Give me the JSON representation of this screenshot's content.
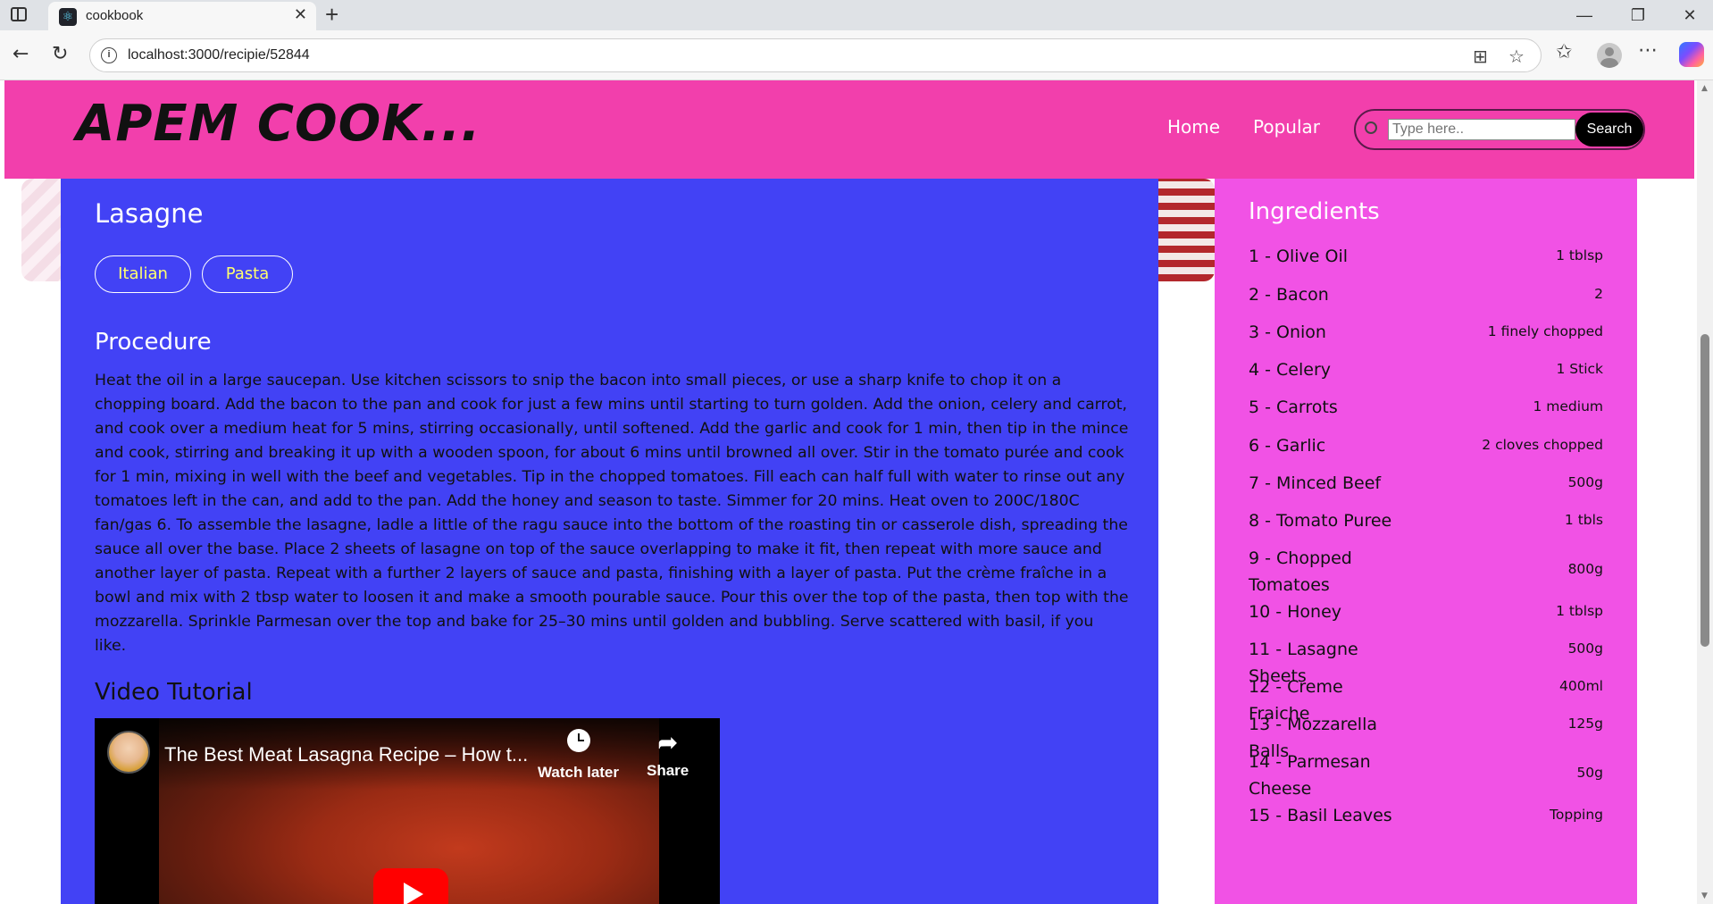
{
  "browser": {
    "tab_title": "cookbook",
    "tab_close": "✕",
    "new_tab": "+",
    "url": "localhost:3000/recipie/52844",
    "info_glyph": "i",
    "window_minimize": "—",
    "window_restore": "❐",
    "window_close": "✕",
    "icons": [
      "sidebar-icon",
      "react-favicon",
      "back-icon",
      "refresh-icon",
      "info-icon",
      "app-available-icon",
      "favorite-star-icon",
      "favorites-icon",
      "profile-icon",
      "more-icon",
      "copilot-icon"
    ]
  },
  "header": {
    "logo": "APEM COOK...",
    "nav": [
      "Home",
      "Popular"
    ],
    "search_placeholder": "Type here..",
    "search_button": "Search",
    "bg_color": "#f23fac"
  },
  "recipe": {
    "title": "Lasagne",
    "tags": [
      "Italian",
      "Pasta"
    ],
    "procedure_heading": "Procedure",
    "procedure_text": "Heat the oil in a large saucepan. Use kitchen scissors to snip the bacon into small pieces, or use a sharp knife to chop it on a chopping board. Add the bacon to the pan and cook for just a few mins until starting to turn golden. Add the onion, celery and carrot, and cook over a medium heat for 5 mins, stirring occasionally, until softened. Add the garlic and cook for 1 min, then tip in the mince and cook, stirring and breaking it up with a wooden spoon, for about 6 mins until browned all over. Stir in the tomato purée and cook for 1 min, mixing in well with the beef and vegetables. Tip in the chopped tomatoes. Fill each can half full with water to rinse out any tomatoes left in the can, and add to the pan. Add the honey and season to taste. Simmer for 20 mins. Heat oven to 200C/180C fan/gas 6. To assemble the lasagne, ladle a little of the ragu sauce into the bottom of the roasting tin or casserole dish, spreading the sauce all over the base. Place 2 sheets of lasagne on top of the sauce overlapping to make it fit, then repeat with more sauce and another layer of pasta. Repeat with a further 2 layers of sauce and pasta, finishing with a layer of pasta. Put the crème fraîche in a bowl and mix with 2 tbsp water to loosen it and make a smooth pourable sauce. Pour this over the top of the pasta, then top with the mozzarella. Sprinkle Parmesan over the top and bake for 25–30 mins until golden and bubbling. Serve scattered with basil, if you like.",
    "video_heading": "Video Tutorial",
    "video": {
      "title": "The Best Meat Lasagna Recipe – How t...",
      "watch_later": "Watch later",
      "share": "Share"
    },
    "panel_color": "#4242f5"
  },
  "ingredients": {
    "heading": "Ingredients",
    "panel_color": "#f152e5",
    "items": [
      {
        "name": "1 - Olive Oil",
        "qty": "1 tblsp"
      },
      {
        "name": "2 - Bacon",
        "qty": "2"
      },
      {
        "name": "3 - Onion",
        "qty": "1 finely chopped"
      },
      {
        "name": "4 - Celery",
        "qty": "1 Stick"
      },
      {
        "name": "5 - Carrots",
        "qty": "1 medium"
      },
      {
        "name": "6 - Garlic",
        "qty": "2 cloves chopped"
      },
      {
        "name": "7 - Minced Beef",
        "qty": "500g"
      },
      {
        "name": "8 - Tomato Puree",
        "qty": "1 tbls"
      },
      {
        "name": "9 - Chopped Tomatoes",
        "qty": "800g"
      },
      {
        "name": "10 - Honey",
        "qty": "1 tblsp"
      },
      {
        "name": "11 - Lasagne Sheets",
        "qty": "500g"
      },
      {
        "name": "12 - Creme Fraiche",
        "qty": "400ml"
      },
      {
        "name": "13 - Mozzarella Balls",
        "qty": "125g"
      },
      {
        "name": "14 - Parmesan Cheese",
        "qty": "50g"
      },
      {
        "name": "15 - Basil Leaves",
        "qty": "Topping"
      }
    ]
  }
}
